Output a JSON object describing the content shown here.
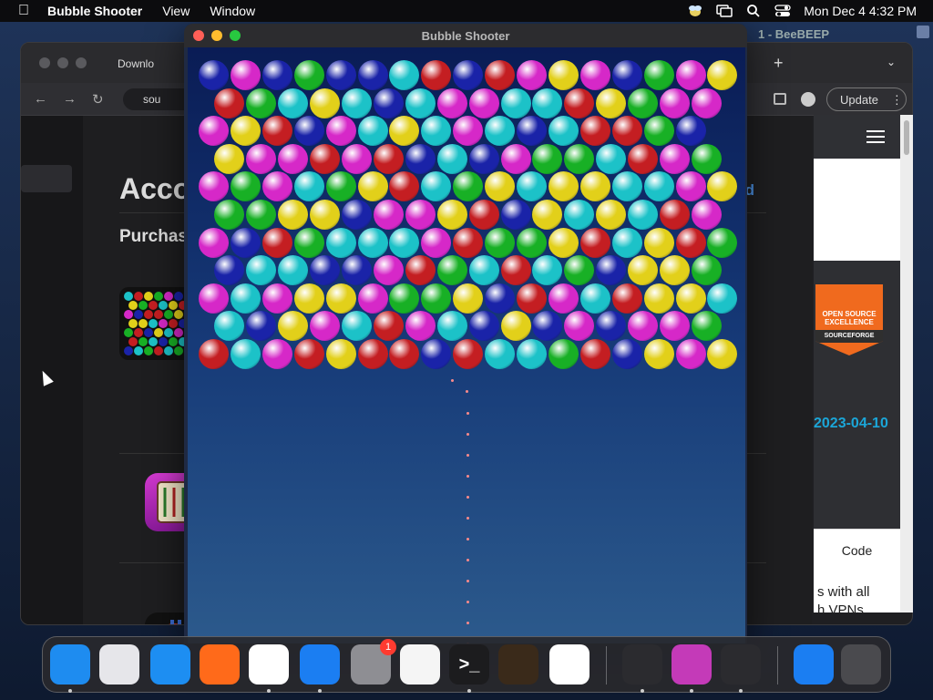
{
  "menubar": {
    "app_name": "Bubble Shooter",
    "menus": [
      "View",
      "Window"
    ],
    "clock": "Mon Dec 4  4:32 PM",
    "icons": [
      "apple-icon",
      "beebeep-status-icon",
      "screen-mirroring-icon",
      "search-icon",
      "control-center-icon"
    ]
  },
  "browser": {
    "tab_title": "Downlo",
    "url_text": "sou",
    "update_label": "Update",
    "page_heading": "Acco",
    "section_heading": "Purchas",
    "right_link_fragment": "rd",
    "right_panel": {
      "badge_line1": "OPEN SOURCE",
      "badge_line2": "EXCELLENCE",
      "badge_line3": "SOURCEFORGE",
      "date_text": "2023-04-10",
      "code_tab": "Code",
      "vpn_line1": "s with all",
      "vpn_line2": "h VPNs"
    }
  },
  "background_window_title": "1 - BeeBEEP",
  "game": {
    "title": "Bubble Shooter",
    "colors": {
      "B": "#1a23a8",
      "M": "#d628c8",
      "G": "#18b025",
      "C": "#1cc2c8",
      "R": "#c41e22",
      "Y": "#e2d01a"
    },
    "rows": [
      "BMBGBBCRBRMYMBGMY",
      "RGCYCBCMMCCRYGMM",
      "MYRBMCYCMCBCRRGB",
      "YMMRMRBCBMGGCRMG",
      "MGMCGYRCGYCYYCCMY",
      "GGYYBMMYRBYCYCRM",
      "MBRGCCCMRGGYRCYRG",
      "BCCBBMRGCRCGBYYG",
      "MCMYYMGGYBRMCRYYC",
      "CBYMCRMCBYBMBMMG",
      "RCMRYRRBRCCGRBYMY"
    ]
  },
  "dock": {
    "apps": [
      {
        "name": "finder-app",
        "label": "",
        "color": "#1e8cf0",
        "running": true
      },
      {
        "name": "launchpad-app",
        "label": "",
        "color": "#e6e6ea",
        "running": false
      },
      {
        "name": "safari-app",
        "label": "",
        "color": "#1d8ef2",
        "running": false
      },
      {
        "name": "firefox-app",
        "label": "",
        "color": "#ff6a1a",
        "running": false
      },
      {
        "name": "chrome-app",
        "label": "",
        "color": "#ffffff",
        "running": true
      },
      {
        "name": "app-store-app",
        "label": "",
        "color": "#1b7ef2",
        "running": true
      },
      {
        "name": "system-settings-app",
        "label": "",
        "color": "#8e8e93",
        "running": false,
        "badge": "1"
      },
      {
        "name": "textedit-app",
        "label": "",
        "color": "#f5f5f5",
        "running": false
      },
      {
        "name": "terminal-app",
        "label": ">_",
        "color": "#1c1c1e",
        "running": true
      },
      {
        "name": "garageband-app",
        "label": "",
        "color": "#3a2a1a",
        "running": false
      },
      {
        "name": "vscode-app",
        "label": "",
        "color": "#ffffff",
        "running": false
      },
      {
        "name": "beebeep-app",
        "label": "",
        "color": "#2b2b2f",
        "running": true
      },
      {
        "name": "maze-game-app",
        "label": "",
        "color": "#c43ab8",
        "running": true
      },
      {
        "name": "bubble-shooter-app",
        "label": "",
        "color": "#2b2b2f",
        "running": true
      },
      {
        "name": "app-store-downloads-app",
        "label": "",
        "color": "#1b7ef2",
        "running": false
      },
      {
        "name": "trash-app",
        "label": "",
        "color": "#4a4a4e",
        "running": false
      }
    ]
  }
}
